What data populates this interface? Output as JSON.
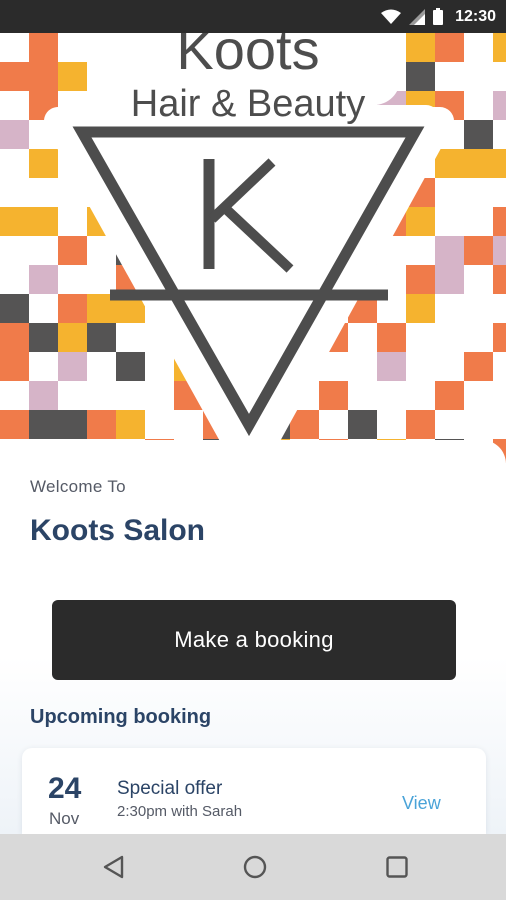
{
  "status_bar": {
    "time": "12:30",
    "icons": [
      "wifi-icon",
      "signal-icon",
      "battery-icon"
    ]
  },
  "hero": {
    "brand_name": "Koots",
    "brand_tagline": "Hair & Beauty",
    "monogram": "K",
    "colors": {
      "orange": "#f07b4a",
      "yellow": "#f5b32f",
      "gray": "#555454",
      "pink": "#d6b4c8",
      "white": "#ffffff",
      "logo_gray": "#4d4d4d"
    }
  },
  "welcome": {
    "subtitle": "Welcome To",
    "title": "Koots Salon"
  },
  "actions": {
    "booking_button": "Make a booking"
  },
  "upcoming": {
    "section_title": "Upcoming booking",
    "items": [
      {
        "day": "24",
        "month": "Nov",
        "title": "Special offer",
        "detail": "2:30pm with Sarah",
        "action": "View"
      }
    ]
  },
  "navigation": {
    "buttons": [
      "back-icon",
      "home-icon",
      "recents-icon"
    ]
  },
  "theme": {
    "primary_text": "#2b4466",
    "secondary_text": "#555a66",
    "button_bg": "#2b2b2b",
    "link": "#4aa3d8"
  }
}
